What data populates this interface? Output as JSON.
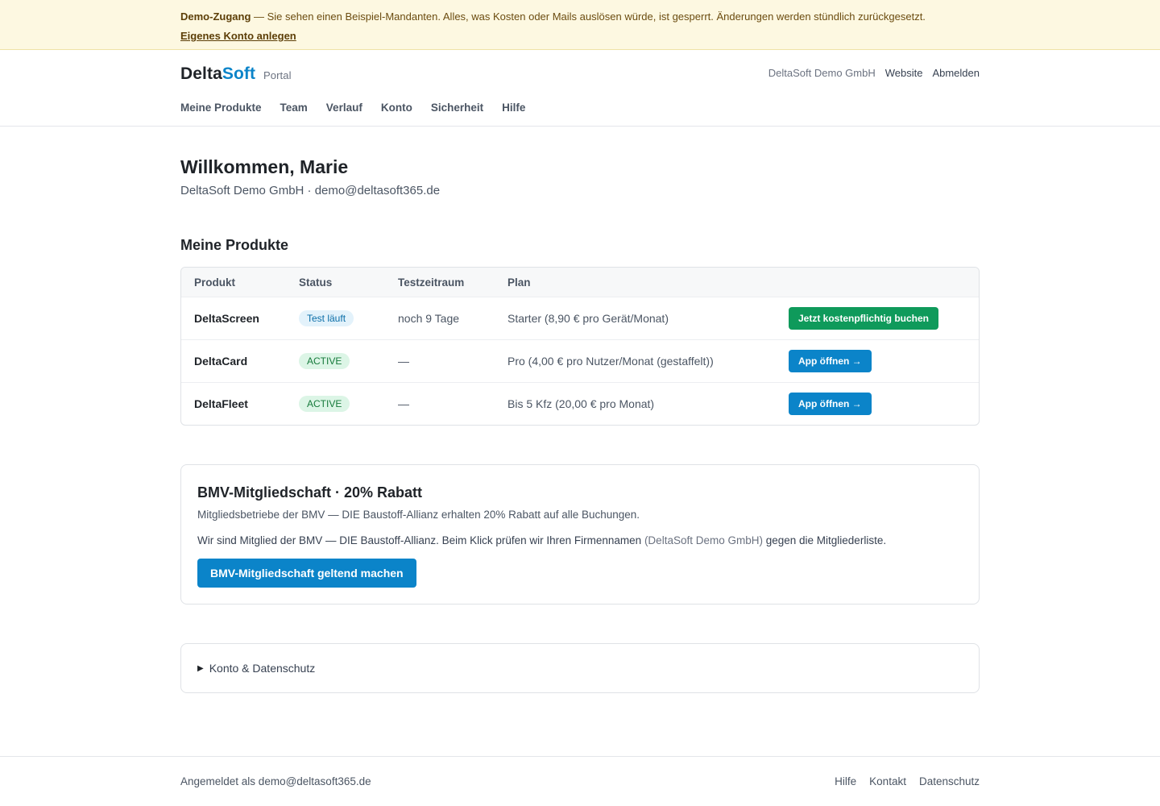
{
  "banner": {
    "title": "Demo-Zugang",
    "text": " — Sie sehen einen Beispiel-Mandanten. Alles, was Kosten oder Mails auslösen würde, ist gesperrt. Änderungen werden stündlich zurückgesetzt.",
    "link": "Eigenes Konto anlegen"
  },
  "header": {
    "brand_delta": "Delta",
    "brand_soft": "Soft",
    "brand_portal": "Portal",
    "org": "DeltaSoft Demo GmbH",
    "website": "Website",
    "logout": "Abmelden",
    "nav": [
      "Meine Produkte",
      "Team",
      "Verlauf",
      "Konto",
      "Sicherheit",
      "Hilfe"
    ]
  },
  "welcome": {
    "title": "Willkommen, Marie",
    "subline": "DeltaSoft Demo GmbH · demo@deltasoft365.de"
  },
  "products": {
    "heading": "Meine Produkte",
    "columns": [
      "Produkt",
      "Status",
      "Testzeitraum",
      "Plan"
    ],
    "rows": [
      {
        "name": "DeltaScreen",
        "status": "Test läuft",
        "trial": "noch 9 Tage",
        "plan": "Starter (8,90 € pro Gerät/Monat)",
        "action": "Jetzt kostenpflichtig buchen"
      },
      {
        "name": "DeltaCard",
        "status": "ACTIVE",
        "trial": "—",
        "plan": "Pro (4,00 € pro Nutzer/Monat (gestaffelt))",
        "action": "App öffnen →"
      },
      {
        "name": "DeltaFleet",
        "status": "ACTIVE",
        "trial": "—",
        "plan": "Bis 5 Kfz (20,00 € pro Monat)",
        "action": "App öffnen →"
      }
    ]
  },
  "bmv": {
    "title": "BMV-Mitgliedschaft · 20% Rabatt",
    "desc": "Mitgliedsbetriebe der BMV — DIE Baustoff-Allianz erhalten 20% Rabatt auf alle Buchungen.",
    "info_before": "Wir sind Mitglied der BMV — DIE Baustoff-Allianz. Beim Klick prüfen wir Ihren Firmennamen ",
    "info_org": "(DeltaSoft Demo GmbH)",
    "info_after": " gegen die Mitgliederliste.",
    "button": "BMV-Mitgliedschaft geltend machen"
  },
  "details": {
    "marker": "▶",
    "label": "Konto & Datenschutz"
  },
  "footer": {
    "logged_in": "Angemeldet als demo@deltasoft365.de",
    "links": [
      "Hilfe",
      "Kontakt",
      "Datenschutz"
    ]
  },
  "colors": {
    "accent": "#0b84c9",
    "success_button": "#0f9a5b",
    "banner_bg": "#fdf8e1"
  }
}
